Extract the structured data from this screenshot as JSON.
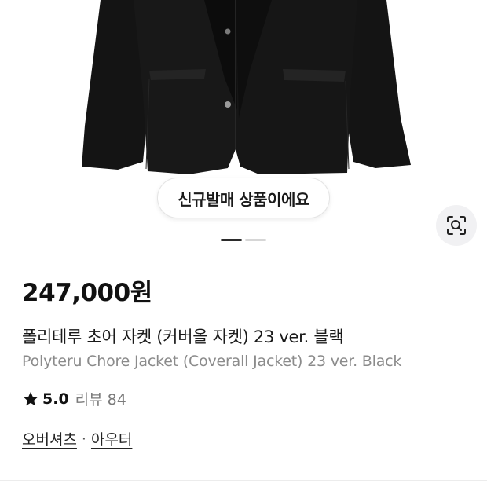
{
  "gallery": {
    "badge_text": "신규발매 상품이에요",
    "lens_icon": "image-search-icon",
    "page_count": 2,
    "active_page": 1
  },
  "product": {
    "price": "247,000원",
    "title_ko": "폴리테루 초어 자켓 (커버올 자켓) 23 ver. 블랙",
    "title_en": "Polyteru Chore Jacket (Coverall Jacket) 23 ver. Black",
    "rating": "5.0",
    "review_label": "리뷰",
    "review_count": "84",
    "categories": [
      "오버셔츠",
      "아우터"
    ],
    "category_separator": "·"
  },
  "colors": {
    "jacket": "#141414",
    "pager_active": "#2b2b2b",
    "pager_inactive": "#d6d6d6",
    "subtext": "#8b8b8b"
  }
}
